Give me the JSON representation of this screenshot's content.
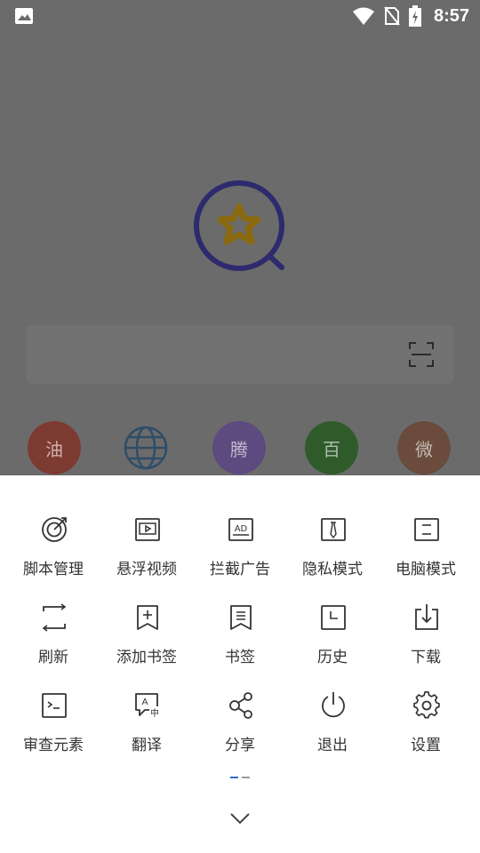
{
  "status": {
    "time": "8:57"
  },
  "shortcuts": [
    {
      "label": "油"
    },
    {
      "label": ""
    },
    {
      "label": "腾"
    },
    {
      "label": "百"
    },
    {
      "label": "微"
    }
  ],
  "menu": {
    "row1": [
      {
        "label": "脚本管理",
        "icon": "target-icon"
      },
      {
        "label": "悬浮视频",
        "icon": "floating-video-icon"
      },
      {
        "label": "拦截广告",
        "icon": "ad-block-icon"
      },
      {
        "label": "隐私模式",
        "icon": "privacy-icon"
      },
      {
        "label": "电脑模式",
        "icon": "desktop-mode-icon"
      }
    ],
    "row2": [
      {
        "label": "刷新",
        "icon": "refresh-icon"
      },
      {
        "label": "添加书签",
        "icon": "add-bookmark-icon"
      },
      {
        "label": "书签",
        "icon": "bookmark-icon"
      },
      {
        "label": "历史",
        "icon": "history-icon"
      },
      {
        "label": "下载",
        "icon": "download-icon"
      }
    ],
    "row3": [
      {
        "label": "审查元素",
        "icon": "inspect-icon"
      },
      {
        "label": "翻译",
        "icon": "translate-icon"
      },
      {
        "label": "分享",
        "icon": "share-icon"
      },
      {
        "label": "退出",
        "icon": "power-icon"
      },
      {
        "label": "设置",
        "icon": "gear-icon"
      }
    ]
  },
  "colors": {
    "accent_blue": "#2f6ec2",
    "logo_ring": "#2e2a6e",
    "logo_star": "#8a6a10"
  }
}
